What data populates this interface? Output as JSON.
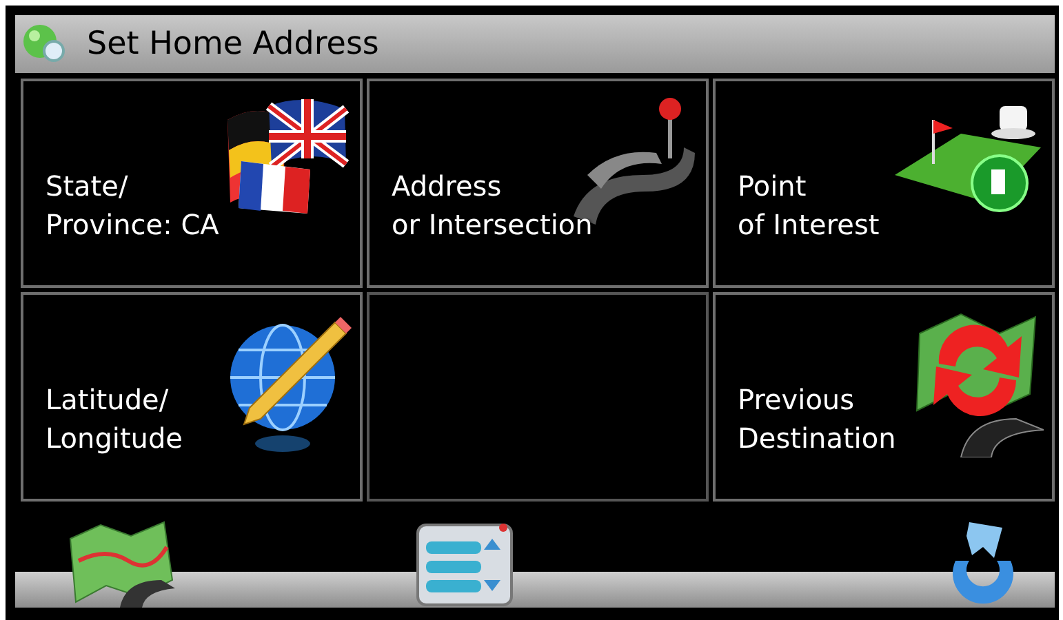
{
  "window": {
    "title": "Set Home Address"
  },
  "tiles": [
    {
      "kind": "flags",
      "label": "State/\nProvince: CA"
    },
    {
      "kind": "road",
      "label": "Address\nor Intersection"
    },
    {
      "kind": "poi",
      "label": "Point\nof Interest"
    },
    {
      "kind": "globe",
      "label": "Latitude/\nLongitude"
    },
    {
      "kind": "empty"
    },
    {
      "kind": "maprefresh",
      "label": "Previous\nDestination"
    }
  ]
}
